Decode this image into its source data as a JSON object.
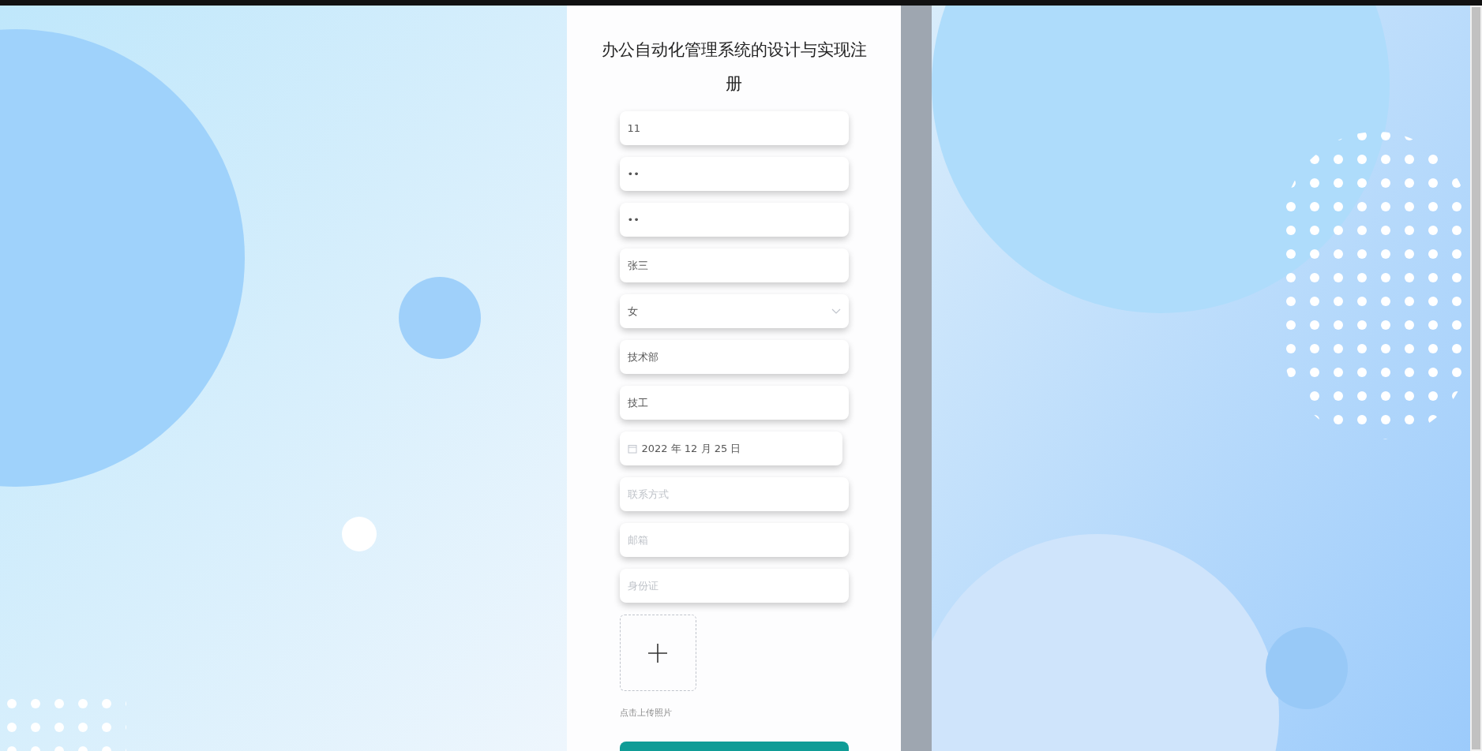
{
  "title": "办公自动化管理系统的设计与实现注册",
  "fields": [
    {
      "kind": "text",
      "value": "11"
    },
    {
      "kind": "password",
      "value": "••"
    },
    {
      "kind": "password",
      "value": "••"
    },
    {
      "kind": "text",
      "value": "张三"
    },
    {
      "kind": "select",
      "value": "女"
    },
    {
      "kind": "text",
      "value": "技术部"
    },
    {
      "kind": "text",
      "value": "技工"
    },
    {
      "kind": "date",
      "value": "2022 年 12 月 25 日"
    },
    {
      "kind": "text",
      "placeholder": "联系方式"
    },
    {
      "kind": "text",
      "placeholder": "邮箱"
    },
    {
      "kind": "text",
      "placeholder": "身份证"
    }
  ],
  "upload": {
    "caption": "点击上传照片"
  }
}
